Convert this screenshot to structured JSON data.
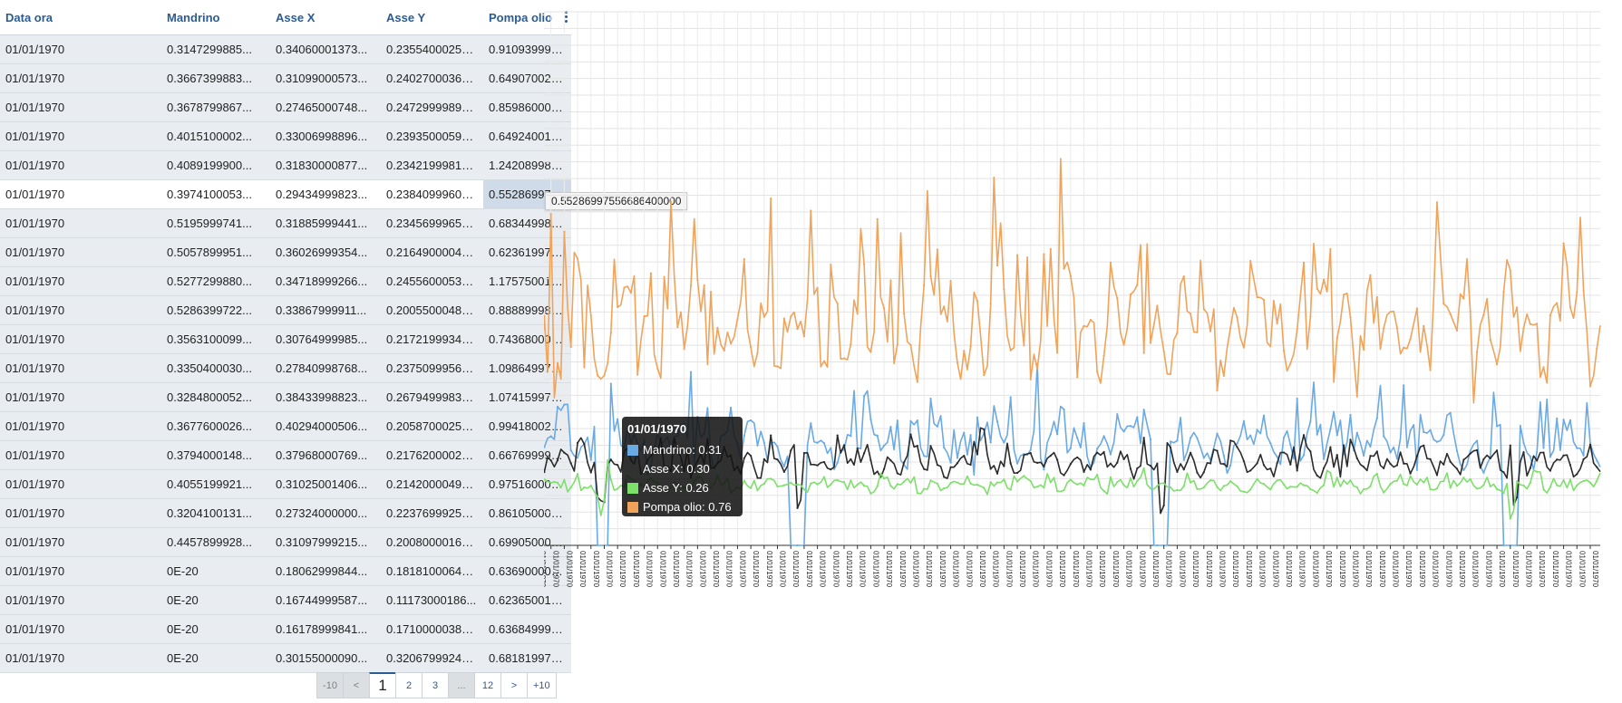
{
  "table": {
    "columns": [
      "Data ora",
      "Mandrino",
      "Asse X",
      "Asse Y",
      "Pompa olio"
    ],
    "selected_row": 5,
    "selected_col": 4,
    "cell_tooltip": "0.55286997556686400000",
    "rows": [
      [
        "01/01/1970",
        "0.3147299885...",
        "0.34060001373...",
        "0.23554000258...",
        "0.9109399914..."
      ],
      [
        "01/01/1970",
        "0.3667399883...",
        "0.31099000573...",
        "0.24027000367...",
        "0.6490700244..."
      ],
      [
        "01/01/1970",
        "0.3678799867...",
        "0.27465000748...",
        "0.24729999899...",
        "0.8598600029..."
      ],
      [
        "01/01/1970",
        "0.4015100002...",
        "0.33006998896...",
        "0.23935000598...",
        "0.6492400169..."
      ],
      [
        "01/01/1970",
        "0.4089199900...",
        "0.31830000877...",
        "0.23421999812...",
        "1.2420899868..."
      ],
      [
        "01/01/1970",
        "0.3974100053...",
        "0.29434999823...",
        "0.23840999603...",
        "0.5528699755..."
      ],
      [
        "01/01/1970",
        "0.5195999741...",
        "0.31885999441...",
        "0.23456999659...",
        "0.6834499835..."
      ],
      [
        "01/01/1970",
        "0.5057899951...",
        "0.36026999354...",
        "0.21649000048...",
        "0.6236199736..."
      ],
      [
        "01/01/1970",
        "0.5277299880...",
        "0.34718999266...",
        "0.24556000530...",
        "1.1757500171..."
      ],
      [
        "01/01/1970",
        "0.5286399722...",
        "0.33867999911...",
        "0.20055000483...",
        "0.8888999819..."
      ],
      [
        "01/01/1970",
        "0.3563100099...",
        "0.30764999985...",
        "0.21721999347...",
        "0.7436800003..."
      ],
      [
        "01/01/1970",
        "0.3350400030...",
        "0.27840998768...",
        "0.23750999569...",
        "1.0986499786..."
      ],
      [
        "01/01/1970",
        "0.3284800052...",
        "0.38433998823...",
        "0.26794999837...",
        "1.0741599798..."
      ],
      [
        "01/01/1970",
        "0.3677600026...",
        "0.40294000506...",
        "0.20587000250...",
        "0.9941800236..."
      ],
      [
        "01/01/1970",
        "0.3794000148...",
        "0.37968000769...",
        "0.21762000024...",
        "0.6676999926..."
      ],
      [
        "01/01/1970",
        "0.4055199921...",
        "0.31025001406...",
        "0.21420000493...",
        "0.9751600027..."
      ],
      [
        "01/01/1970",
        "0.3204100131...",
        "0.27324000000...",
        "0.22376999258...",
        "0.8610500097..."
      ],
      [
        "01/01/1970",
        "0.4457899928...",
        "0.31097999215...",
        "0.20080000162...",
        "0.6990500092..."
      ],
      [
        "01/01/1970",
        "0E-20",
        "0.18062999844...",
        "0.18181000649...",
        "0.6369000077..."
      ],
      [
        "01/01/1970",
        "0E-20",
        "0.16744999587...",
        "0.11173000186...",
        "0.6236500144..."
      ],
      [
        "01/01/1970",
        "0E-20",
        "0.16178999841...",
        "0.17100000381...",
        "0.6368499994..."
      ],
      [
        "01/01/1970",
        "0E-20",
        "0.30155000090...",
        "0.32067999243...",
        "0.6818199753..."
      ]
    ]
  },
  "pager": {
    "items": [
      "-10",
      "<",
      "1",
      "2",
      "3",
      "...",
      "12",
      ">",
      "+10"
    ],
    "current": "1"
  },
  "chart_data": {
    "type": "line",
    "x_label_text": "01/01/1970",
    "x_count": 320,
    "ylim": [
      0,
      2
    ],
    "y_ticks": [
      "0.0000",
      "0.0625",
      "0.1250",
      "0.1875",
      "0.2500",
      "0.3125",
      "0.3750",
      "0.4375",
      "0.5000",
      "0.5625",
      "0.6250",
      "0.6875",
      "0.7500",
      "0.8125",
      "0.8750",
      "0.9375",
      "1.0000",
      "1.0625",
      "1.1250",
      "1.1875",
      "1.2500",
      "1.3125",
      "1.3750",
      "1.4375",
      "1.5000",
      "1.5625",
      "1.6250",
      "1.6875",
      "1.7500",
      "1.8125",
      "1.8750",
      "1.9375",
      "2.0000"
    ],
    "grid": true,
    "series": [
      {
        "name": "Mandrino",
        "color": "#6aaae4",
        "base": 0.38,
        "noise": 0.09,
        "spikes": [
          [
            46,
            0.65
          ],
          [
            95,
            0.58
          ],
          [
            118,
            0.55
          ],
          [
            150,
            0.68
          ],
          [
            228,
            0.55
          ],
          [
            260,
            0.6
          ]
        ],
        "values_head": [
          0.3147,
          0.3667,
          0.3679,
          0.4015,
          0.4089,
          0.3974,
          0.5196,
          0.5058,
          0.5277,
          0.5286,
          0.3563,
          0.335,
          0.3285,
          0.3678,
          0.3794,
          0.4055,
          0.3204,
          0.4458,
          0,
          0,
          0,
          0
        ],
        "zero_runs": [
          [
            76,
            80
          ],
          [
            185,
            189
          ],
          [
            290,
            294
          ]
        ]
      },
      {
        "name": "Asse X",
        "color": "#2b2b2b",
        "base": 0.31,
        "noise": 0.05,
        "spikes": [],
        "values_head": [
          0.3406,
          0.311,
          0.2747,
          0.3301,
          0.3183,
          0.2943,
          0.3189,
          0.3603,
          0.3472,
          0.3387,
          0.3076,
          0.2784,
          0.3843,
          0.4029,
          0.3797,
          0.3103,
          0.2732,
          0.311,
          0.1806,
          0.1674,
          0.1618,
          0.3016
        ],
        "dips": [
          [
            78,
            0.14
          ],
          [
            187,
            0.12
          ],
          [
            293,
            0.15
          ]
        ]
      },
      {
        "name": "Asse Y",
        "color": "#7de06a",
        "base": 0.225,
        "noise": 0.025,
        "spikes": [],
        "values_head": [
          0.2355,
          0.2403,
          0.2473,
          0.2394,
          0.2342,
          0.2384,
          0.2346,
          0.2165,
          0.2456,
          0.2006,
          0.2172,
          0.2375,
          0.2679,
          0.2059,
          0.2176,
          0.2142,
          0.2238,
          0.2008,
          0.1818,
          0.1117,
          0.171,
          0.3207
        ],
        "dips": [
          [
            292,
            0.1
          ]
        ]
      },
      {
        "name": "Pompa olio",
        "color": "#f0a35a",
        "base": 0.82,
        "noise": 0.2,
        "spikes": [
          [
            70,
            1.3
          ],
          [
            137,
            1.38
          ],
          [
            157,
            1.45
          ],
          [
            172,
            1.06
          ],
          [
            183,
            1.13
          ],
          [
            230,
            1.06
          ],
          [
            313,
            1.23
          ]
        ],
        "values_head": [
          0.9109,
          0.6491,
          0.8599,
          0.6492,
          1.2421,
          0.5529,
          0.6834,
          0.6236,
          1.1758,
          0.8889,
          0.7437,
          1.0986,
          1.0742,
          0.9942,
          0.6677,
          0.9752,
          0.8611,
          0.6991,
          0.6369,
          0.6237,
          0.6368,
          0.6818
        ]
      }
    ],
    "tooltip": {
      "title": "01/01/1970",
      "rows": [
        {
          "label": "Mandrino: 0.31",
          "color": "#6aaae4"
        },
        {
          "label": "Asse X: 0.30",
          "color": ""
        },
        {
          "label": "Asse Y: 0.26",
          "color": "#7de06a"
        },
        {
          "label": "Pompa olio: 0.76",
          "color": "#f0a35a"
        }
      ]
    }
  }
}
